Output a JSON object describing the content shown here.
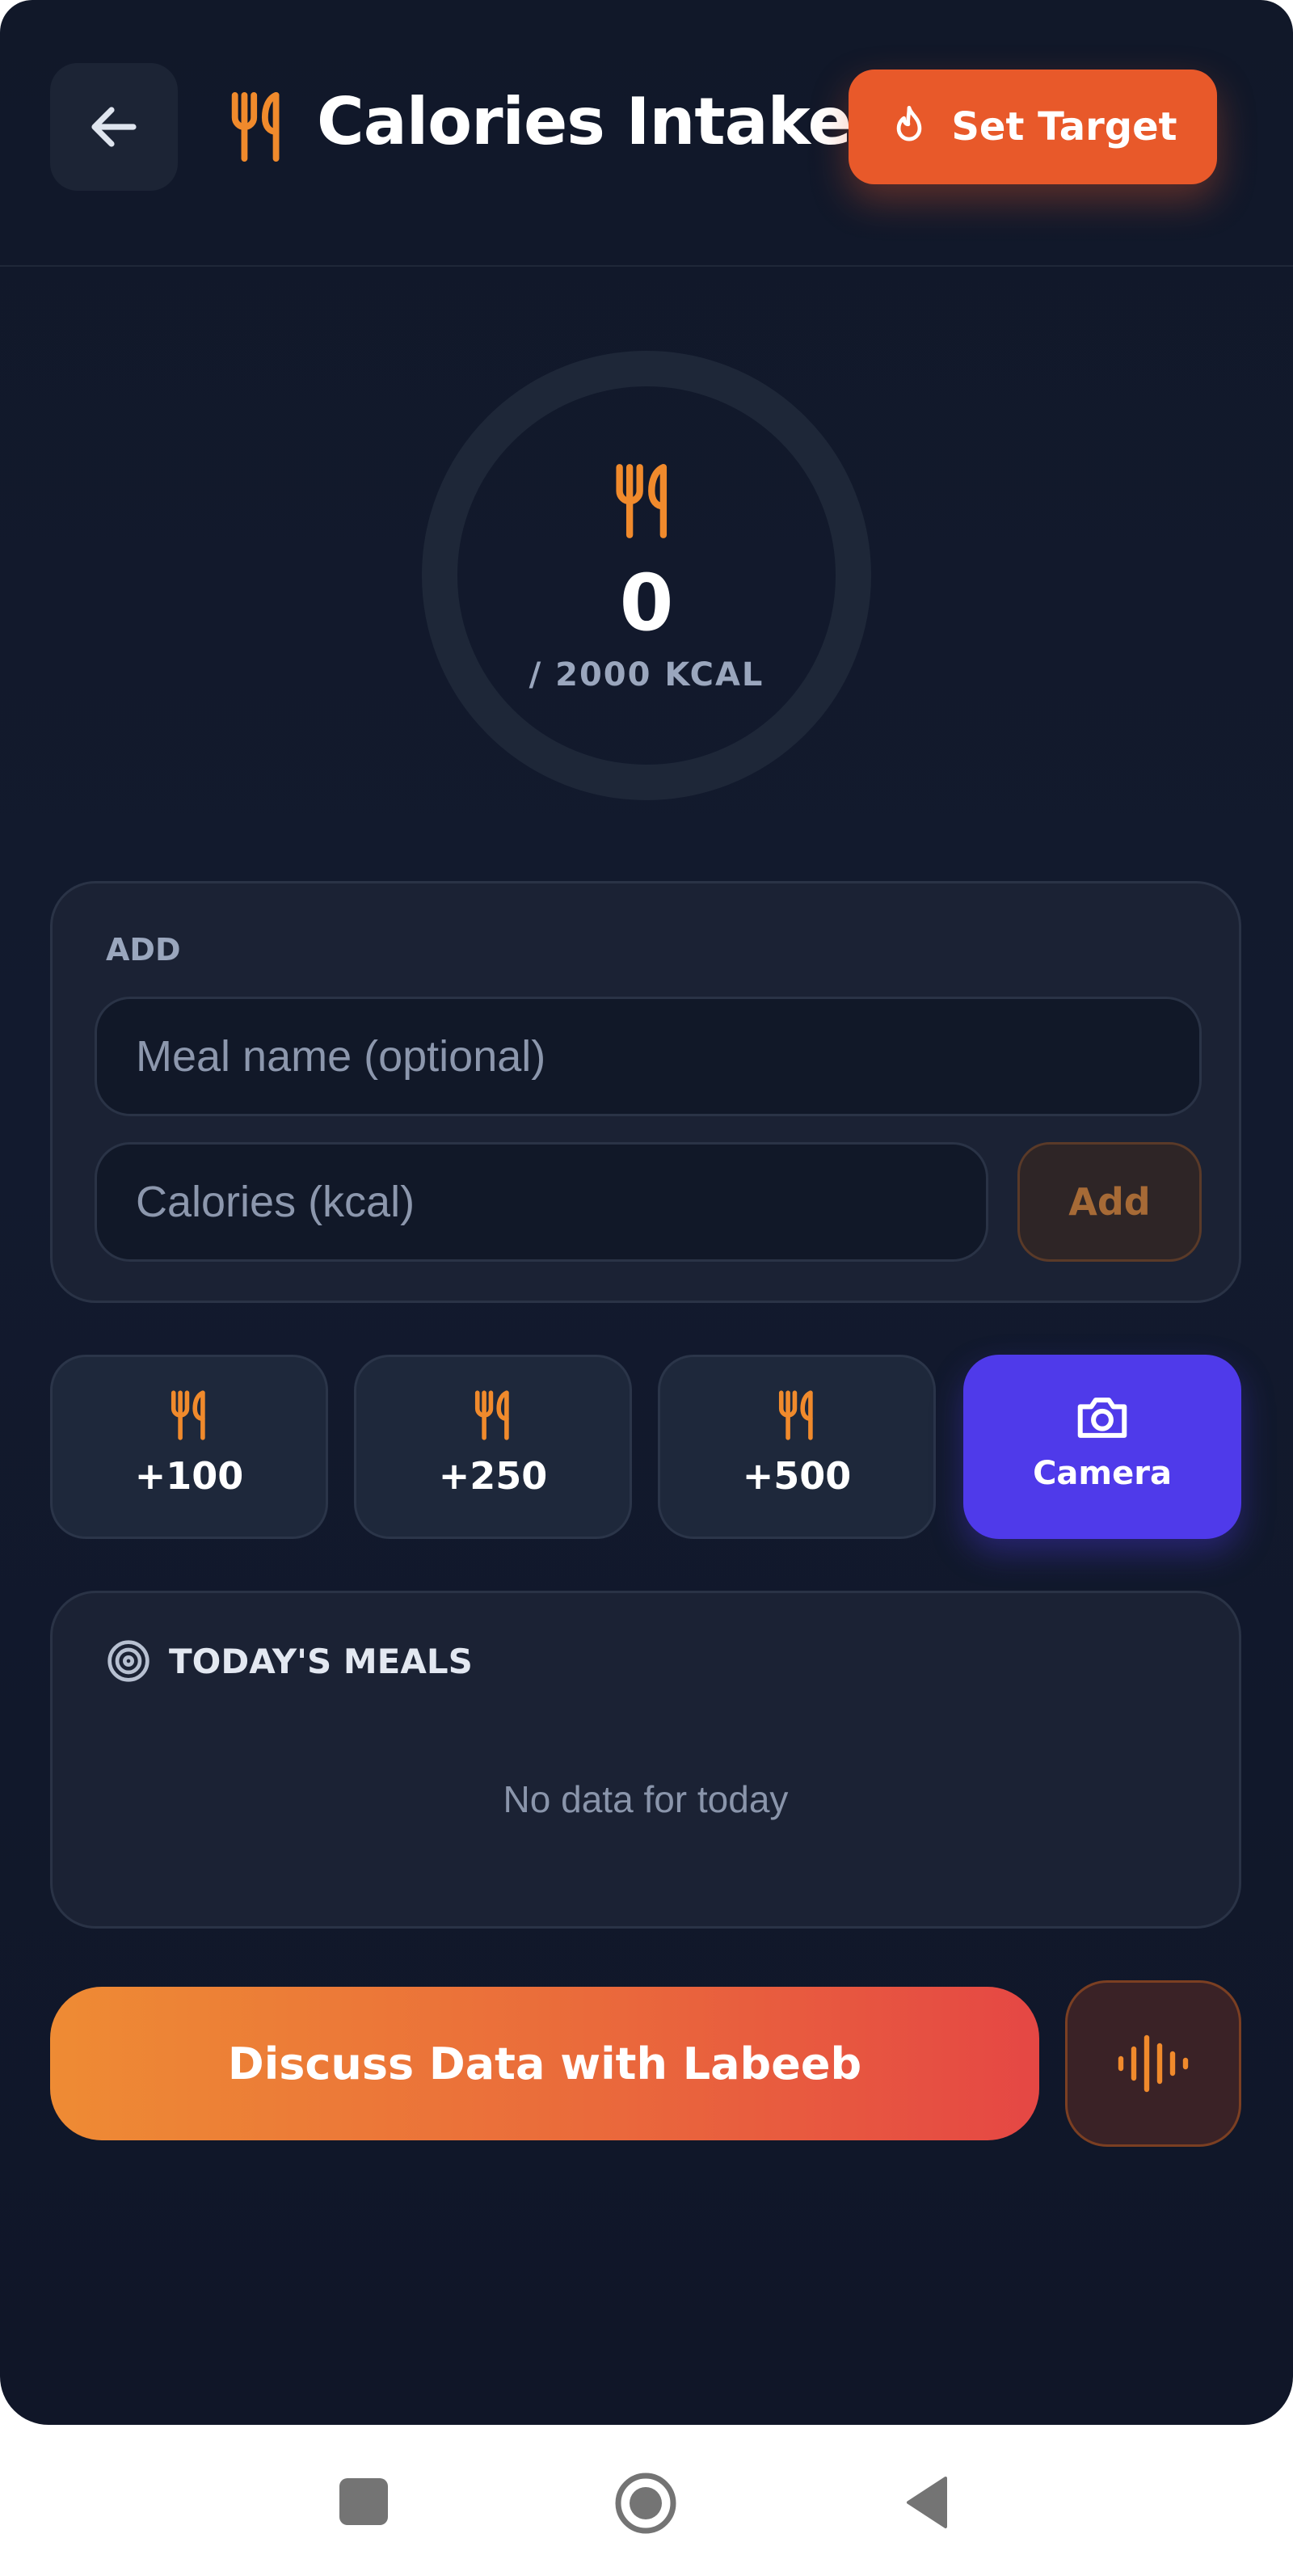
{
  "header": {
    "back_icon": "arrow-left-icon",
    "title_icon": "fork-knife-icon",
    "title": "Calories Intake",
    "set_target_icon": "flame-icon",
    "set_target_label": "Set Target"
  },
  "summary": {
    "icon": "fork-knife-icon",
    "value": "0",
    "target_text": "/ 2000 KCAL",
    "progress": 0
  },
  "add_form": {
    "section_label": "ADD",
    "meal_placeholder": "Meal name (optional)",
    "meal_value": "",
    "calories_placeholder": "Calories (kcal)",
    "calories_value": "",
    "add_label": "Add"
  },
  "quick_add": {
    "items": [
      {
        "label": "+100",
        "icon": "fork-knife-icon"
      },
      {
        "label": "+250",
        "icon": "fork-knife-icon"
      },
      {
        "label": "+500",
        "icon": "fork-knife-icon"
      }
    ],
    "camera": {
      "label": "Camera",
      "icon": "camera-icon"
    }
  },
  "meals": {
    "icon": "target-icon",
    "title": "TODAY'S MEALS",
    "empty_text": "No data for today"
  },
  "actions": {
    "discuss_label": "Discuss Data with Labeeb",
    "voice_icon": "sound-wave-icon"
  },
  "system_nav": {
    "recents_icon": "square-icon",
    "home_icon": "home-circle-icon",
    "back_icon": "triangle-back-icon"
  },
  "colors": {
    "background": "#111829",
    "card": "#1b2234",
    "accent_orange": "#e8592a",
    "icon_orange": "#f08a2c",
    "camera_purple": "#4f3aea",
    "text_muted": "#9aa6bd"
  }
}
